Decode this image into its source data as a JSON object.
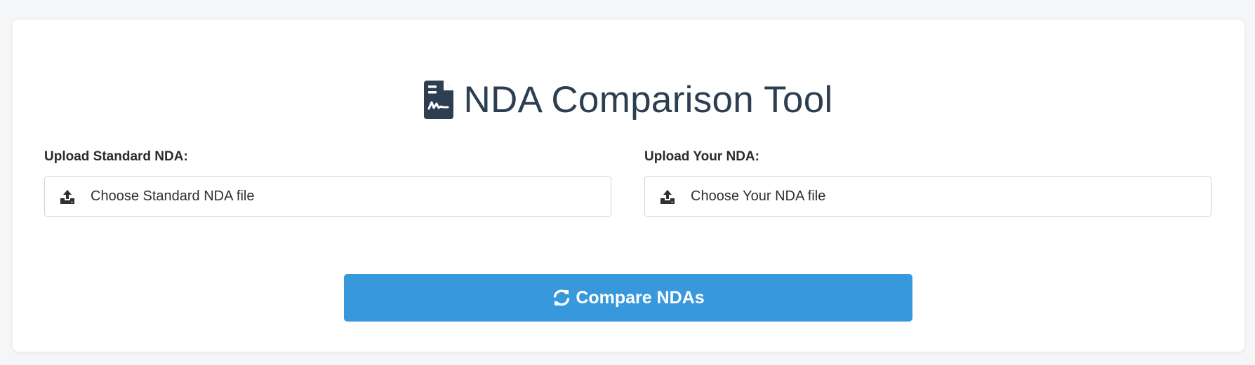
{
  "title": {
    "text": "NDA Comparison Tool",
    "icon": "file-contract-icon"
  },
  "uploads": {
    "standard": {
      "label": "Upload Standard NDA:",
      "button_text": "Choose Standard NDA file",
      "icon": "upload-icon"
    },
    "yours": {
      "label": "Upload Your NDA:",
      "button_text": "Choose Your NDA file",
      "icon": "upload-icon"
    }
  },
  "compare_button": {
    "label": "Compare NDAs",
    "icon": "sync-icon"
  },
  "colors": {
    "accent": "#3798db",
    "title": "#2c3e50",
    "background": "#f5f6f8"
  }
}
